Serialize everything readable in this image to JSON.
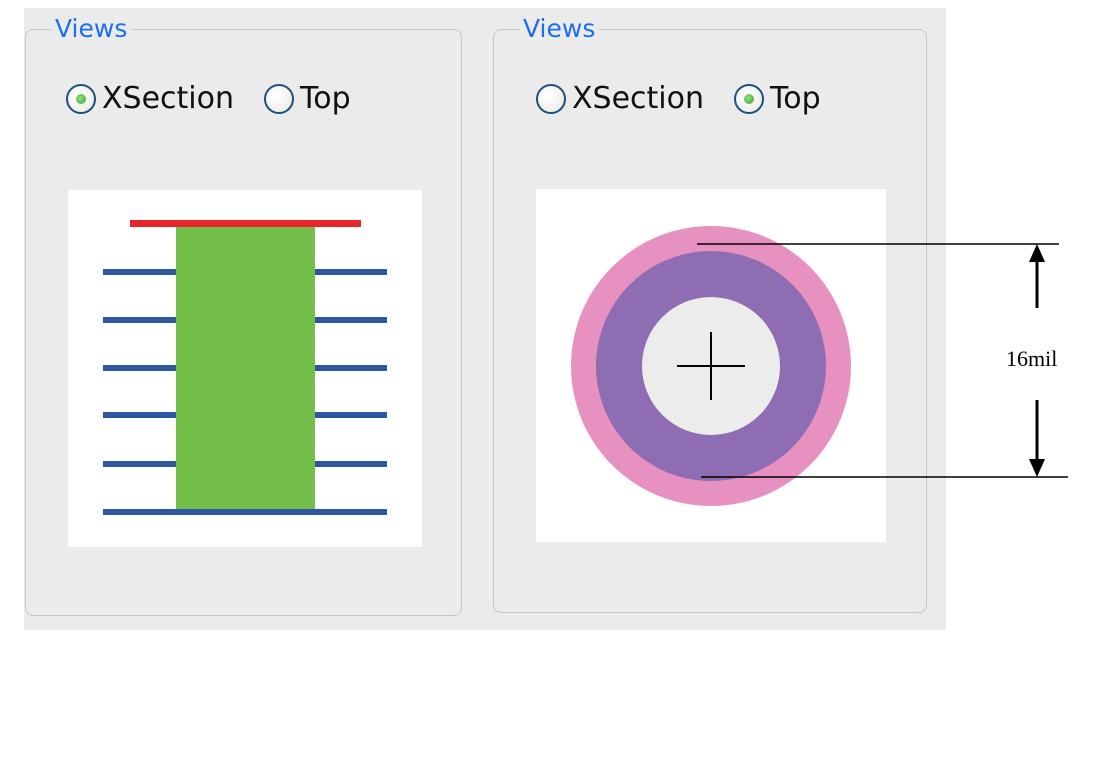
{
  "views_left": {
    "legend": "Views",
    "options": [
      {
        "label": "XSection",
        "checked": true
      },
      {
        "label": "Top",
        "checked": false
      }
    ]
  },
  "views_right": {
    "legend": "Views",
    "options": [
      {
        "label": "XSection",
        "checked": false
      },
      {
        "label": "Top",
        "checked": true
      }
    ]
  },
  "colors": {
    "legend_text": "#1e6ef0",
    "pad_top": "#e8252b",
    "barrel": "#73bf4a",
    "layers": "#2f55a5",
    "outer_ring": "#e791c1",
    "inner_ring": "#8e6db2",
    "hole": "#ececec"
  },
  "annotation": {
    "dimension_label": "16mil"
  }
}
